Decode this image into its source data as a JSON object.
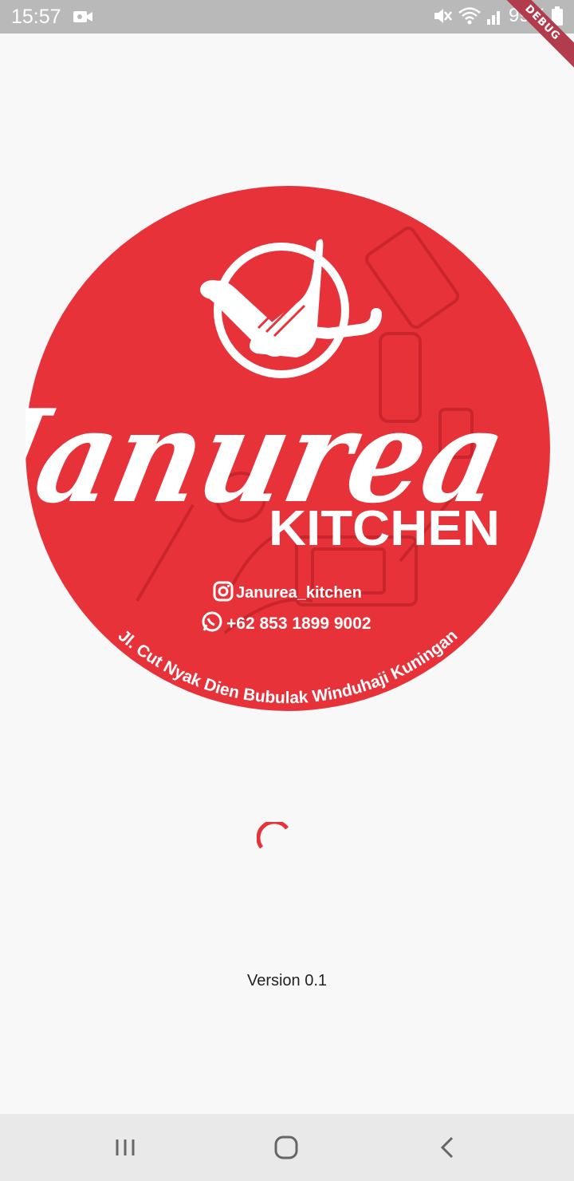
{
  "status_bar": {
    "time": "15:57",
    "battery": "99%"
  },
  "debug_banner": "DEBUG",
  "logo": {
    "brand_name": "Janurea",
    "subtitle": "KITCHEN",
    "instagram": "Janurea_kitchen",
    "phone": "+62 853 1899 9002",
    "address": "Jl. Cut Nyak Dien Bubulak Winduhaji Kuningan",
    "colors": {
      "circle": "#e8323a",
      "text": "#ffffff"
    }
  },
  "loading_indicator_color": "#e8323a",
  "version_text": "Version 0.1",
  "nav_bar": {
    "recent": "recent-apps",
    "home": "home",
    "back": "back"
  }
}
